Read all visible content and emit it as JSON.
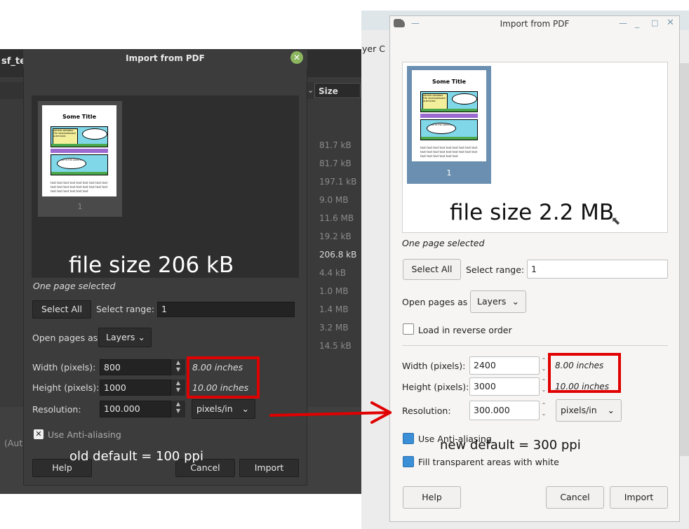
{
  "left": {
    "bg_tab_text": "sf_te",
    "column_header": "Size",
    "bg_left_bottom_text": "(Aut",
    "file_sizes": [
      "81.7 kB",
      "81.7 kB",
      "197.1 kB",
      "9.0 MB",
      "11.6 MB",
      "19.2 kB",
      "206.8 kB",
      "4.4 kB",
      "1.0 MB",
      "1.4 MB",
      "3.2 MB",
      "14.5 kB"
    ],
    "dialog": {
      "title": "Import from PDF",
      "page_title": "Some Title",
      "page_number": "1",
      "status": "One page selected",
      "select_all": "Select All",
      "select_range_label": "Select range:",
      "select_range_value": "1",
      "open_pages_label": "Open pages as",
      "open_pages_value": "Layers",
      "width_label": "Width (pixels):",
      "width_value": "800",
      "width_inches": "8.00 inches",
      "height_label": "Height (pixels):",
      "height_value": "1000",
      "height_inches": "10.00 inches",
      "resolution_label": "Resolution:",
      "resolution_value": "100.000",
      "resolution_unit": "pixels/in",
      "antialias_label": "Use Anti-aliasing",
      "help": "Help",
      "cancel": "Cancel",
      "import": "Import"
    },
    "annotation_size": "file size 206 kB",
    "annotation_default": "old default = 100 ppi"
  },
  "right": {
    "bg_menu_text": "yer  C",
    "dialog": {
      "title": "Import from PDF",
      "page_title": "Some Title",
      "page_number": "1",
      "status": "One page selected",
      "select_all": "Select All",
      "select_range_label": "Select range:",
      "select_range_value": "1",
      "open_pages_label": "Open pages as",
      "open_pages_value": "Layers",
      "reverse_label": "Load in reverse order",
      "width_label": "Width (pixels):",
      "width_value": "2400",
      "width_inches": "8.00 inches",
      "height_label": "Height (pixels):",
      "height_value": "3000",
      "height_inches": "10.00 inches",
      "resolution_label": "Resolution:",
      "resolution_value": "300.000",
      "resolution_unit": "pixels/in",
      "antialias_label": "Use Anti-aliasing",
      "fill_white_label": "Fill transparent areas with white",
      "help": "Help",
      "cancel": "Cancel",
      "import": "Import"
    },
    "annotation_size": "file size 2.2 MB",
    "annotation_default": "new default = 300 ppi"
  },
  "comic": {
    "speech1": "ARTHUR ANSWERS THE UNANSWERABLE QUESTIONS",
    "speech2": "WHAT IS THE QUESTION?",
    "body_text": "text text text text text text text text text text text text text text text text text text text text text text text text"
  },
  "colors": {
    "annotation_red": "#e00000",
    "checkbox_blue": "#3a8fd6",
    "close_green": "#8bb65f"
  }
}
